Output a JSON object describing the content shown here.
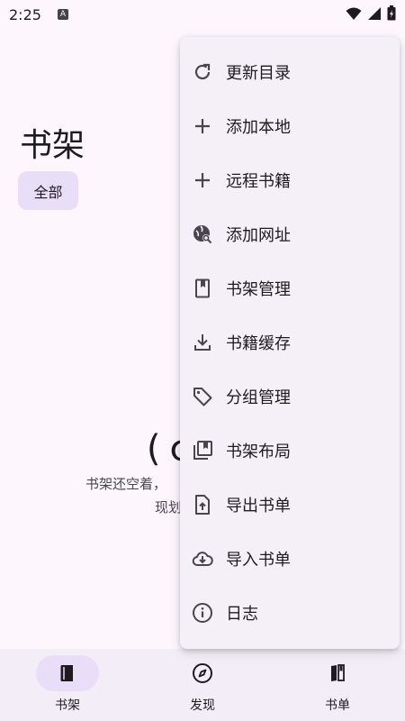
{
  "status_bar": {
    "time": "2:25",
    "notification_icon": "A",
    "icons": [
      "wifi-icon",
      "signal-icon",
      "battery-icon"
    ]
  },
  "page": {
    "title": "书架",
    "filter_chip": "全部"
  },
  "empty_state": {
    "emoticon": "(ｏ'",
    "line1": "书架还空着，",
    "line2": "现划"
  },
  "menu": {
    "items": [
      {
        "label": "更新目录",
        "icon": "refresh-icon"
      },
      {
        "label": "添加本地",
        "icon": "plus-icon"
      },
      {
        "label": "远程书籍",
        "icon": "plus-icon"
      },
      {
        "label": "添加网址",
        "icon": "web-search-icon"
      },
      {
        "label": "书架管理",
        "icon": "bookmark-icon"
      },
      {
        "label": "书籍缓存",
        "icon": "download-icon"
      },
      {
        "label": "分组管理",
        "icon": "tag-icon"
      },
      {
        "label": "书架布局",
        "icon": "library-icon"
      },
      {
        "label": "导出书单",
        "icon": "file-upload-icon"
      },
      {
        "label": "导入书单",
        "icon": "cloud-download-icon"
      },
      {
        "label": "日志",
        "icon": "info-icon"
      }
    ]
  },
  "bottom_nav": {
    "items": [
      {
        "label": "书架",
        "icon": "book-icon",
        "active": true
      },
      {
        "label": "发现",
        "icon": "compass-icon",
        "active": false
      },
      {
        "label": "书单",
        "icon": "booklist-icon",
        "active": false
      }
    ]
  },
  "colors": {
    "background": "#fdf7fd",
    "menu_surface": "#f5eff7",
    "chip": "#e8def8",
    "nav_surface": "#f3edf7",
    "text": "#1d1b20",
    "icon": "#49454f"
  }
}
